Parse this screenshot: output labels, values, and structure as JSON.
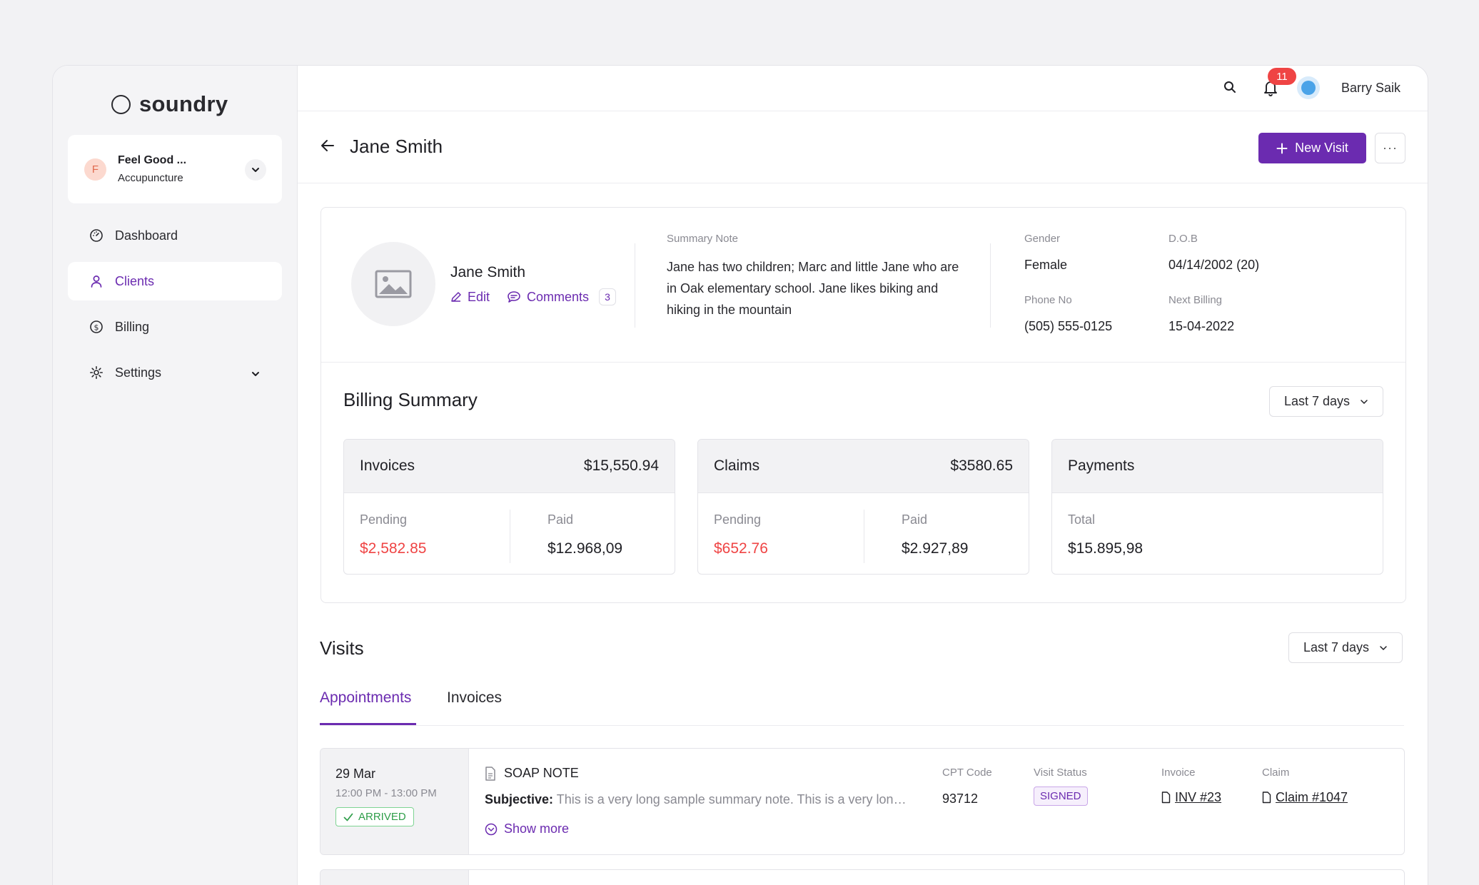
{
  "brand": {
    "name": "soundry"
  },
  "org": {
    "initial": "F",
    "name": "Feel Good ...",
    "subtitle": "Accupuncture"
  },
  "sidebar": {
    "items": [
      {
        "label": "Dashboard",
        "icon": "gauge-icon"
      },
      {
        "label": "Clients",
        "icon": "user-icon",
        "active": true
      },
      {
        "label": "Billing",
        "icon": "dollar-circle-icon"
      },
      {
        "label": "Settings",
        "icon": "gear-icon"
      }
    ]
  },
  "topbar": {
    "notifications": "11",
    "user_name": "Barry Saik"
  },
  "header": {
    "title": "Jane Smith",
    "new_visit_label": "New Visit",
    "more_label": "···"
  },
  "profile": {
    "name": "Jane Smith",
    "edit_label": "Edit",
    "comments_label": "Comments",
    "comments_count": "3",
    "summary_note_label": "Summary Note",
    "summary_note": "Jane has two children; Marc and little Jane who are in Oak elementary school. Jane likes biking and hiking in the mountain",
    "gender_label": "Gender",
    "gender": "Female",
    "dob_label": "D.O.B",
    "dob": "04/14/2002 (20)",
    "phone_label": "Phone No",
    "phone": "(505) 555-0125",
    "next_billing_label": "Next Billing",
    "next_billing": "15-04-2022"
  },
  "billing": {
    "title": "Billing Summary",
    "range": "Last 7 days",
    "invoices": {
      "title": "Invoices",
      "total": "$15,550.94",
      "pending_label": "Pending",
      "pending": "$2,582.85",
      "paid_label": "Paid",
      "paid": "$12.968,09"
    },
    "claims": {
      "title": "Claims",
      "total": "$3580.65",
      "pending_label": "Pending",
      "pending": "$652.76",
      "paid_label": "Paid",
      "paid": "$2.927,89"
    },
    "payments": {
      "title": "Payments",
      "total_label": "Total",
      "total": "$15.895,98"
    }
  },
  "visits": {
    "title": "Visits",
    "range": "Last 7 days",
    "tabs": [
      "Appointments",
      "Invoices"
    ],
    "rows": [
      {
        "date": "29 Mar",
        "time": "12:00 PM - 13:00 PM",
        "status": "ARRIVED",
        "type": "SOAP NOTE",
        "subjective_label": "Subjective:",
        "subjective": "This is a very long sample summary note. This is a very long sample summary note.",
        "show_more": "Show more",
        "cpt_label": "CPT Code",
        "cpt": "93712",
        "visit_status_label": "Visit Status",
        "visit_status": "SIGNED",
        "invoice_label": "Invoice",
        "invoice": "INV #23",
        "claim_label": "Claim",
        "claim": "Claim #1047"
      }
    ]
  },
  "colors": {
    "accent": "#6b2bb0",
    "danger": "#ef4444",
    "success": "#2f9e4a"
  }
}
